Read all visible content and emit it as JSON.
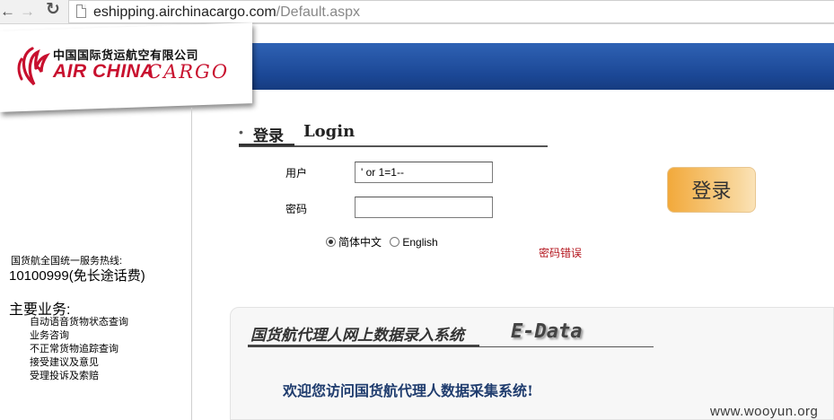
{
  "browser": {
    "back_icon": "arrow-left-icon",
    "forward_icon": "arrow-right-icon",
    "reload_icon": "reload-icon",
    "page_icon": "page-icon",
    "url_host": "eshipping.airchinacargo.com",
    "url_path": "/Default.aspx"
  },
  "logo": {
    "cn": "中国国际货运航空有限公司",
    "en_air": "AIR CHINA",
    "en_cargo": "CARGO",
    "brand_color": "#c8102e"
  },
  "header": {
    "band_color": "#1f4d9c"
  },
  "sidebar": {
    "hotline_label": "国货航全国统一服务热线:",
    "hotline_number": "10100999(免长途话费)",
    "business_title": "主要业务:",
    "business_items": [
      "自动语音货物状态查询",
      "业务咨询",
      "不正常货物追踪查询",
      "接受建议及意见",
      "受理投诉及索赔"
    ]
  },
  "login": {
    "bullet": "•",
    "title_cn": "登录",
    "title_en": "Login",
    "user_label": "用户",
    "user_value": "' or 1=1--",
    "password_label": "密码",
    "password_value": "",
    "lang_options": [
      {
        "label": "简体中文",
        "checked": true
      },
      {
        "label": "English",
        "checked": false
      }
    ],
    "error_message": "密码错误",
    "button_label": "登录"
  },
  "edata": {
    "title_cn": "国货航代理人网上数据录入系统",
    "title_en": "E-Data",
    "welcome": "欢迎您访问国货航代理人数据采集系统!"
  },
  "watermark": "www.wooyun.org"
}
